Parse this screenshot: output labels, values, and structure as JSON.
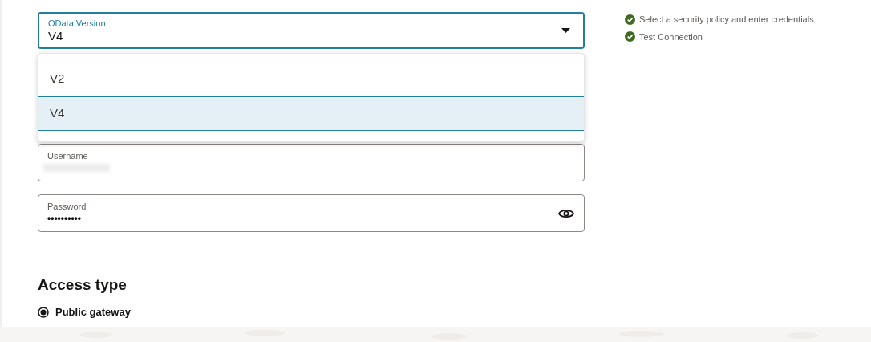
{
  "odata_version": {
    "label": "OData Version",
    "value": "V4",
    "expanded": true,
    "options": [
      {
        "label": "V2",
        "selected": false
      },
      {
        "label": "V4",
        "selected": true
      }
    ]
  },
  "username": {
    "label": "Username"
  },
  "password": {
    "label": "Password",
    "value": "••••••••••"
  },
  "access_type": {
    "heading": "Access type",
    "options": [
      {
        "label": "Public gateway",
        "selected": true
      }
    ]
  },
  "steps": [
    {
      "label": "Select a security policy and enter credentials",
      "checked": true
    },
    {
      "label": "Test Connection",
      "checked": true
    }
  ]
}
